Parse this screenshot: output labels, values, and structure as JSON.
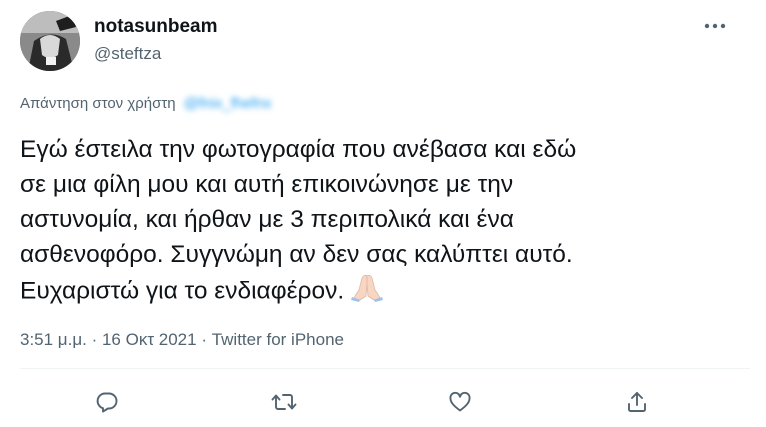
{
  "author": {
    "display_name": "notasunbeam",
    "handle": "@steftza"
  },
  "reply_context": {
    "prefix": "Απάντηση στον χρήστη",
    "mention": "@fnix_fhefnx"
  },
  "tweet": {
    "lines": [
      "Εγώ έστειλα την φωτογραφία που ανέβασα και εδώ",
      "σε μια φίλη μου και αυτή επικοινώνησε με την",
      "αστυνομία, και ήρθαν με 3 περιπολικά και ένα",
      "ασθενοφόρο. Συγγνώμη αν δεν σας καλύπτει αυτό.",
      "Ευχαριστώ για το ενδιαφέρον."
    ],
    "emoji": "folded-hands-icon"
  },
  "meta": {
    "time": "3:51 μ.μ.",
    "separator": " · ",
    "date": "16 Οκτ 2021",
    "source": "Twitter for iPhone"
  },
  "icons": {
    "more": "more-icon",
    "reply": "reply-icon",
    "retweet": "retweet-icon",
    "like": "like-icon",
    "share": "share-icon"
  },
  "colors": {
    "text": "#0f1419",
    "secondary": "#536471",
    "accent": "#1d9bf0",
    "divider": "#eff3f4"
  }
}
